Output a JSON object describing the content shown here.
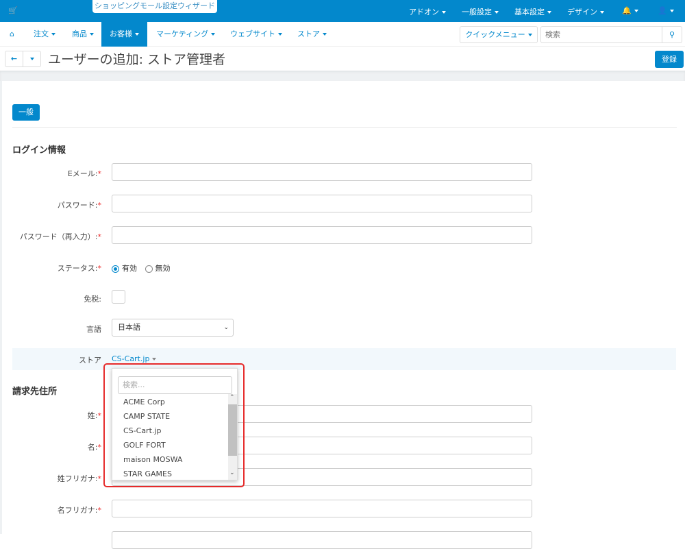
{
  "topbar": {
    "wizard": "ショッピングモール設定ウィザード",
    "menus": [
      "アドオン",
      "一般設定",
      "基本設定",
      "デザイン"
    ]
  },
  "nav": {
    "items": [
      "注文",
      "商品",
      "お客様",
      "マーケティング",
      "ウェブサイト",
      "ストア"
    ],
    "quick_menu": "クイックメニュー",
    "search_placeholder": "検索"
  },
  "header": {
    "title": "ユーザーの追加: ストア管理者",
    "save": "登録"
  },
  "tabs": {
    "general": "一般"
  },
  "login": {
    "heading": "ログイン情報",
    "email": "Eメール:",
    "password": "パスワード:",
    "password_confirm": "パスワード（再入力）:",
    "status": "ステータス:",
    "status_active": "有効",
    "status_inactive": "無効",
    "tax_exempt": "免税:",
    "language": "言語",
    "language_value": "日本語",
    "store": "ストア",
    "store_value": "CS-Cart.jp"
  },
  "dropdown": {
    "search_placeholder": "検索...",
    "options": [
      "ACME Corp",
      "CAMP STATE",
      "CS-Cart.jp",
      "GOLF FORT",
      "maison MOSWA",
      "STAR GAMES"
    ]
  },
  "billing": {
    "heading": "請求先住所",
    "last_name": "姓:",
    "first_name": "名:",
    "last_kana": "姓フリガナ:",
    "first_kana": "名フリガナ:"
  },
  "required_mark": "*"
}
